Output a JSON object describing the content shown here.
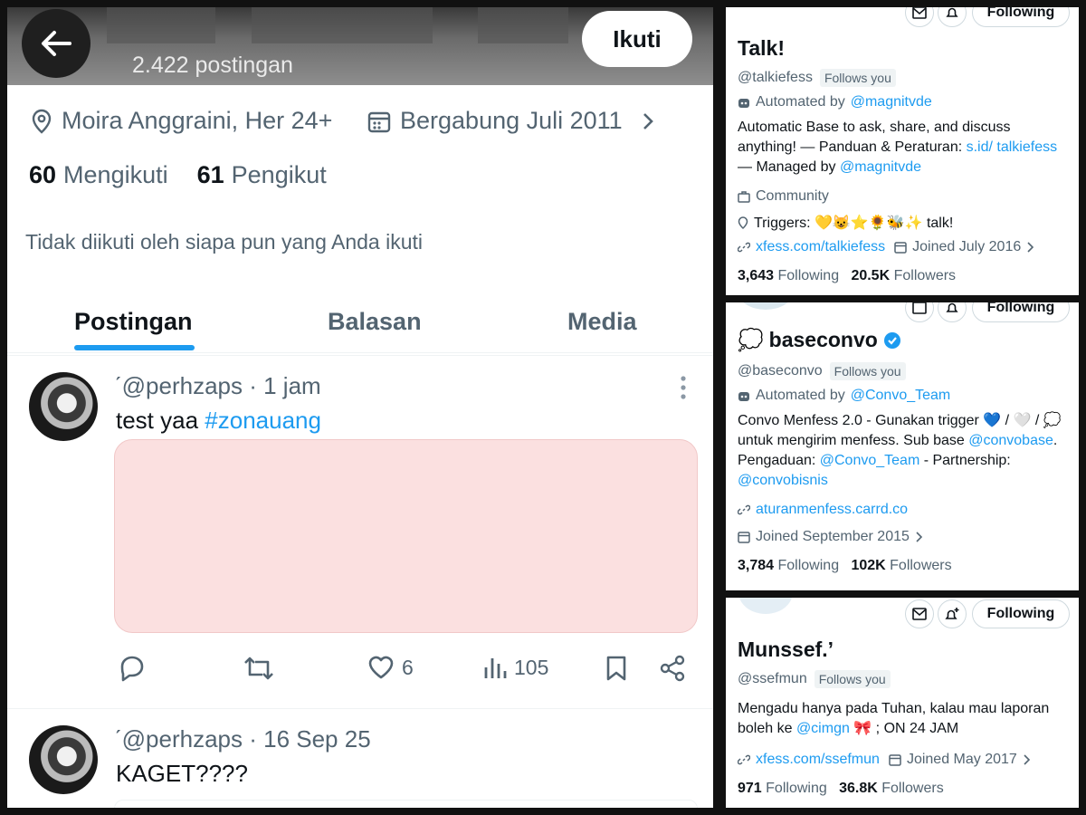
{
  "left": {
    "post_count": "2.422 postingan",
    "follow_button": "Ikuti",
    "location": "Moira Anggraini, Her 24+",
    "joined": "Bergabung Juli 2011",
    "following_count": "60",
    "following_label": "Mengikuti",
    "followers_count": "61",
    "followers_label": "Pengikut",
    "not_followed": "Tidak diikuti oleh siapa pun yang Anda ikuti",
    "tabs": [
      "Postingan",
      "Balasan",
      "Media"
    ],
    "posts": [
      {
        "handle": "ˊ@perhzaps · 1 jam",
        "text": "test yaa ",
        "hashtag": "#zonauang",
        "likes": "6",
        "views": "105"
      },
      {
        "handle": "ˊ@perhzaps · 16 Sep 25",
        "text": "KAGET????"
      }
    ]
  },
  "panels": [
    {
      "name": "Talk!",
      "username": "@talkiefess",
      "follows_you": "Follows you",
      "automated_prefix": "Automated by ",
      "automated_by": "@magnitvde",
      "bio_1": "Automatic Base to ask, share, and discuss anything! — Panduan & Peraturan: ",
      "bio_link": "s.id/ talkiefess",
      "bio_2": " — Managed by ",
      "bio_mention": "@magnitvde",
      "category": "Community",
      "triggers": "Triggers: 💛😺⭐🌻🐝✨ talk!",
      "website": "xfess.com/talkiefess",
      "joined": "Joined July 2016",
      "following": "3,643",
      "following_label": "Following",
      "followers": "20.5K",
      "followers_label": "Followers",
      "top_button": "Following"
    },
    {
      "name": "baseconvo",
      "name_emoji": "💭",
      "username": "@baseconvo",
      "follows_you": "Follows you",
      "automated_prefix": "Automated by ",
      "automated_by": "@Convo_Team",
      "bio_1": "Convo Menfess 2.0 - Gunakan trigger 💙 / 🤍 / 💭 untuk mengirim menfess. Sub base ",
      "bio_m1": "@convobase",
      "bio_2": ". Pengaduan: ",
      "bio_m2": "@Convo_Team",
      "bio_3": " - Partnership: ",
      "bio_m3": "@convobisnis",
      "website": "aturanmenfess.carrd.co",
      "joined": "Joined September 2015",
      "following": "3,784",
      "following_label": "Following",
      "followers": "102K",
      "followers_label": "Followers",
      "top_button": "Following"
    },
    {
      "name": "Munssef.ʼ",
      "username": "@ssefmun",
      "follows_you": "Follows you",
      "bio_1": "Mengadu hanya pada Tuhan, kalau mau laporan boleh ke ",
      "bio_mention": "@cimgn",
      "bio_2": " 🎀 ; ON 24 JAM",
      "website": "xfess.com/ssefmun",
      "joined": "Joined May 2017",
      "following": "971",
      "following_label": "Following",
      "followers": "36.8K",
      "followers_label": "Followers",
      "top_button": "Following"
    }
  ],
  "colors": {
    "accent": "#1d9bf0",
    "verified": "#1d9bf0",
    "media_placeholder": "#fbe0e0"
  }
}
